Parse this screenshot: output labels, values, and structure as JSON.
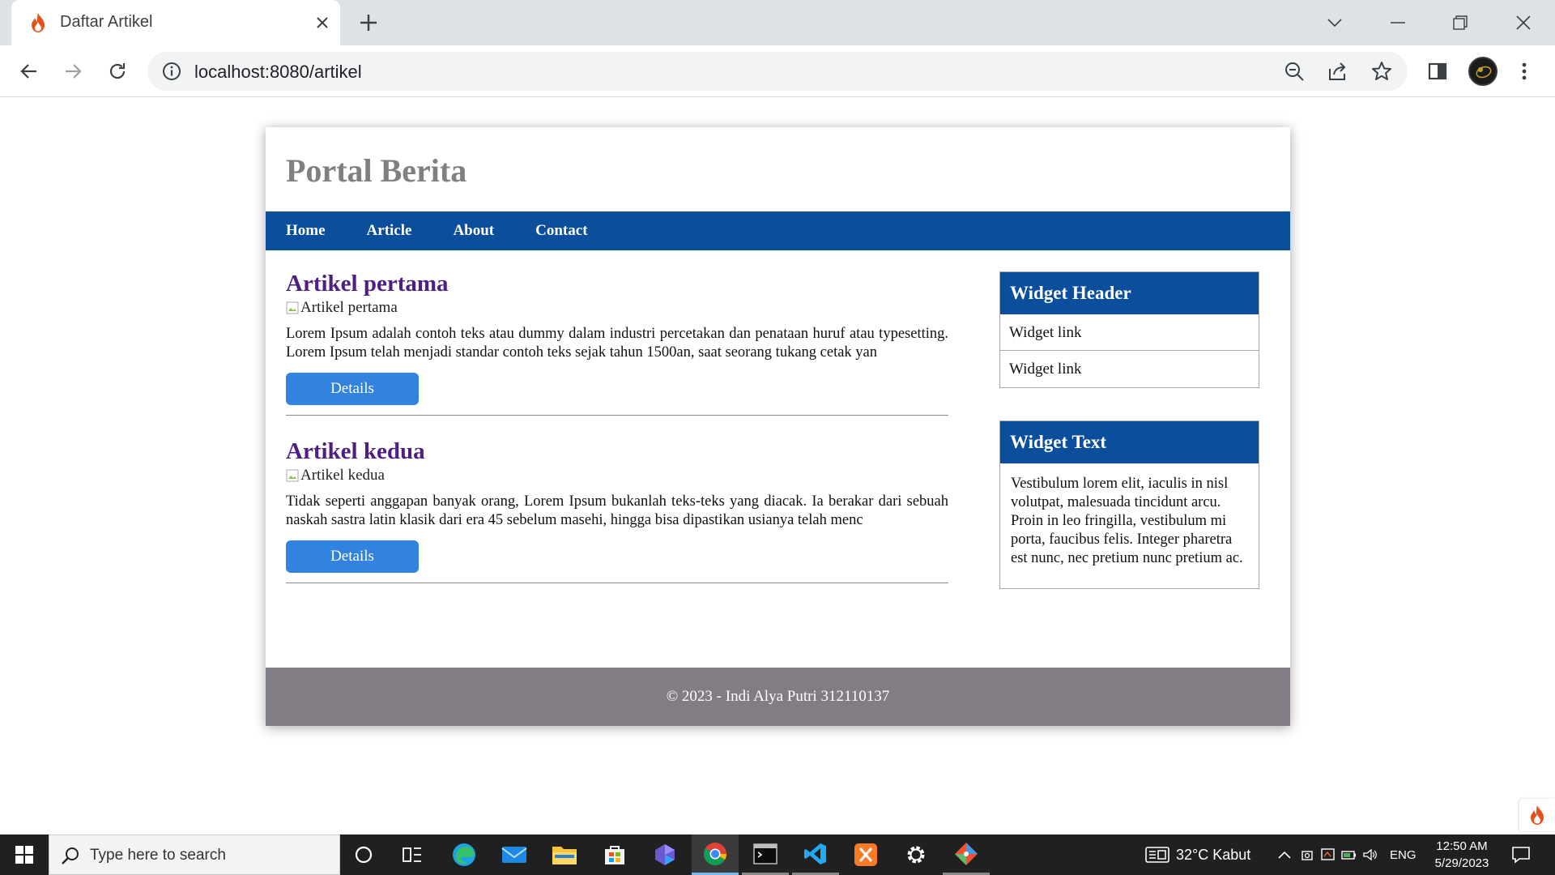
{
  "browser": {
    "tab_title": "Daftar Artikel",
    "url": "localhost:8080/artikel"
  },
  "page": {
    "site_title": "Portal Berita",
    "nav": [
      "Home",
      "Article",
      "About",
      "Contact"
    ],
    "articles": [
      {
        "title": "Artikel pertama",
        "image_alt": "Artikel pertama",
        "excerpt": "Lorem Ipsum adalah contoh teks atau dummy dalam industri percetakan dan penataan huruf atau typesetting. Lorem Ipsum telah menjadi standar contoh teks sejak tahun 1500an, saat seorang tukang cetak yan",
        "button": "Details"
      },
      {
        "title": "Artikel kedua",
        "image_alt": "Artikel kedua",
        "excerpt": "Tidak seperti anggapan banyak orang, Lorem Ipsum bukanlah teks-teks yang diacak. Ia berakar dari sebuah naskah sastra latin klasik dari era 45 sebelum masehi, hingga bisa dipastikan usianya telah menc",
        "button": "Details"
      }
    ],
    "widgets": {
      "header_title": "Widget Header",
      "links": [
        "Widget link",
        "Widget link"
      ],
      "text_title": "Widget Text",
      "text_body": "Vestibulum lorem elit, iaculis in nisl volutpat, malesuada tincidunt arcu. Proin in leo fringilla, vestibulum mi porta, faucibus felis. Integer pharetra est nunc, nec pretium nunc pretium ac."
    },
    "footer": "© 2023 - Indi Alya Putri 312110137"
  },
  "taskbar": {
    "search_placeholder": "Type here to search",
    "weather": "32°C  Kabut",
    "lang": "ENG",
    "time": "12:50 AM",
    "date": "5/29/2023"
  },
  "colors": {
    "nav_blue": "#0b4f9c",
    "article_title": "#4d1f83",
    "button_blue": "#3283df",
    "footer_gray": "#827d84",
    "site_title_gray": "#808080"
  },
  "icons": [
    "flame-icon",
    "close-icon",
    "plus-icon",
    "chevron-down-icon",
    "minimize-icon",
    "restore-icon",
    "back-arrow-icon",
    "forward-arrow-icon",
    "reload-icon",
    "info-icon",
    "zoom-out-icon",
    "share-icon",
    "star-icon",
    "side-panel-icon",
    "more-vert-icon",
    "windows-icon",
    "search-icon",
    "cortana-icon",
    "task-view-icon",
    "edge-icon",
    "mail-icon",
    "file-explorer-icon",
    "store-icon",
    "app-icon",
    "chrome-icon",
    "terminal-icon",
    "vscode-icon",
    "xampp-icon",
    "settings-icon",
    "git-icon",
    "weather-icon",
    "tray-chevron-icon",
    "notification-icon"
  ]
}
